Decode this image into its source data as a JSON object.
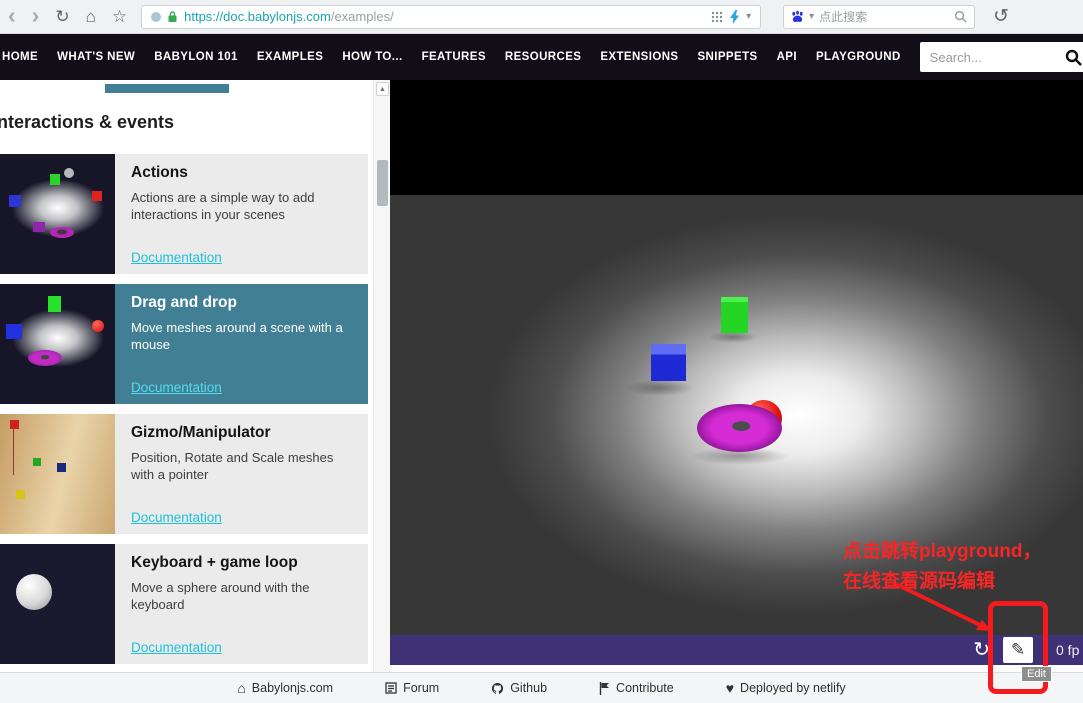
{
  "browser": {
    "url": {
      "scheme": "https://",
      "host": "doc.babylonjs.com",
      "path": "/examples/"
    },
    "search_placeholder": "点此搜索"
  },
  "nav": {
    "items": [
      "HOME",
      "WHAT'S NEW",
      "BABYLON 101",
      "EXAMPLES",
      "HOW TO...",
      "FEATURES",
      "RESOURCES",
      "EXTENSIONS",
      "SNIPPETS",
      "API",
      "PLAYGROUND"
    ],
    "search_placeholder": "Search..."
  },
  "sidebar": {
    "section_title": "Interactions & events",
    "cards": [
      {
        "title": "Actions",
        "description": "Actions are a simple way to add interactions in your scenes",
        "link": "Documentation",
        "selected": false
      },
      {
        "title": "Drag and drop",
        "description": "Move meshes around a scene with a mouse",
        "link": "Documentation",
        "selected": true
      },
      {
        "title": "Gizmo/Manipulator",
        "description": "Position, Rotate and Scale meshes with a pointer",
        "link": "Documentation",
        "selected": false
      },
      {
        "title": "Keyboard + game loop",
        "description": "Move a sphere around with the keyboard",
        "link": "Documentation",
        "selected": false
      }
    ]
  },
  "scene": {
    "fps": "0 fp",
    "edit_tooltip": "Edit"
  },
  "annotation": {
    "line1": "点击跳转playground，",
    "line2": "在线查看源码编辑"
  },
  "footer": {
    "items": [
      "Babylonjs.com",
      "Forum",
      "Github",
      "Contribute",
      "Deployed by netlify"
    ]
  },
  "icons": {
    "back": "‹",
    "forward": "›",
    "refresh": "↻",
    "home": "⌂",
    "star": "☆",
    "caret_down": "▾",
    "history": "↺",
    "scroll_up": "▲",
    "reload": "↻",
    "pencil": "✎",
    "footer_home": "⌂",
    "heart": "♥"
  },
  "colors": {
    "accent_link": "#1fc1d8",
    "selected_card": "#417f95",
    "annotation_red": "#f92525",
    "player_bar": "#3f3175",
    "nav_bg": "#110e18"
  }
}
